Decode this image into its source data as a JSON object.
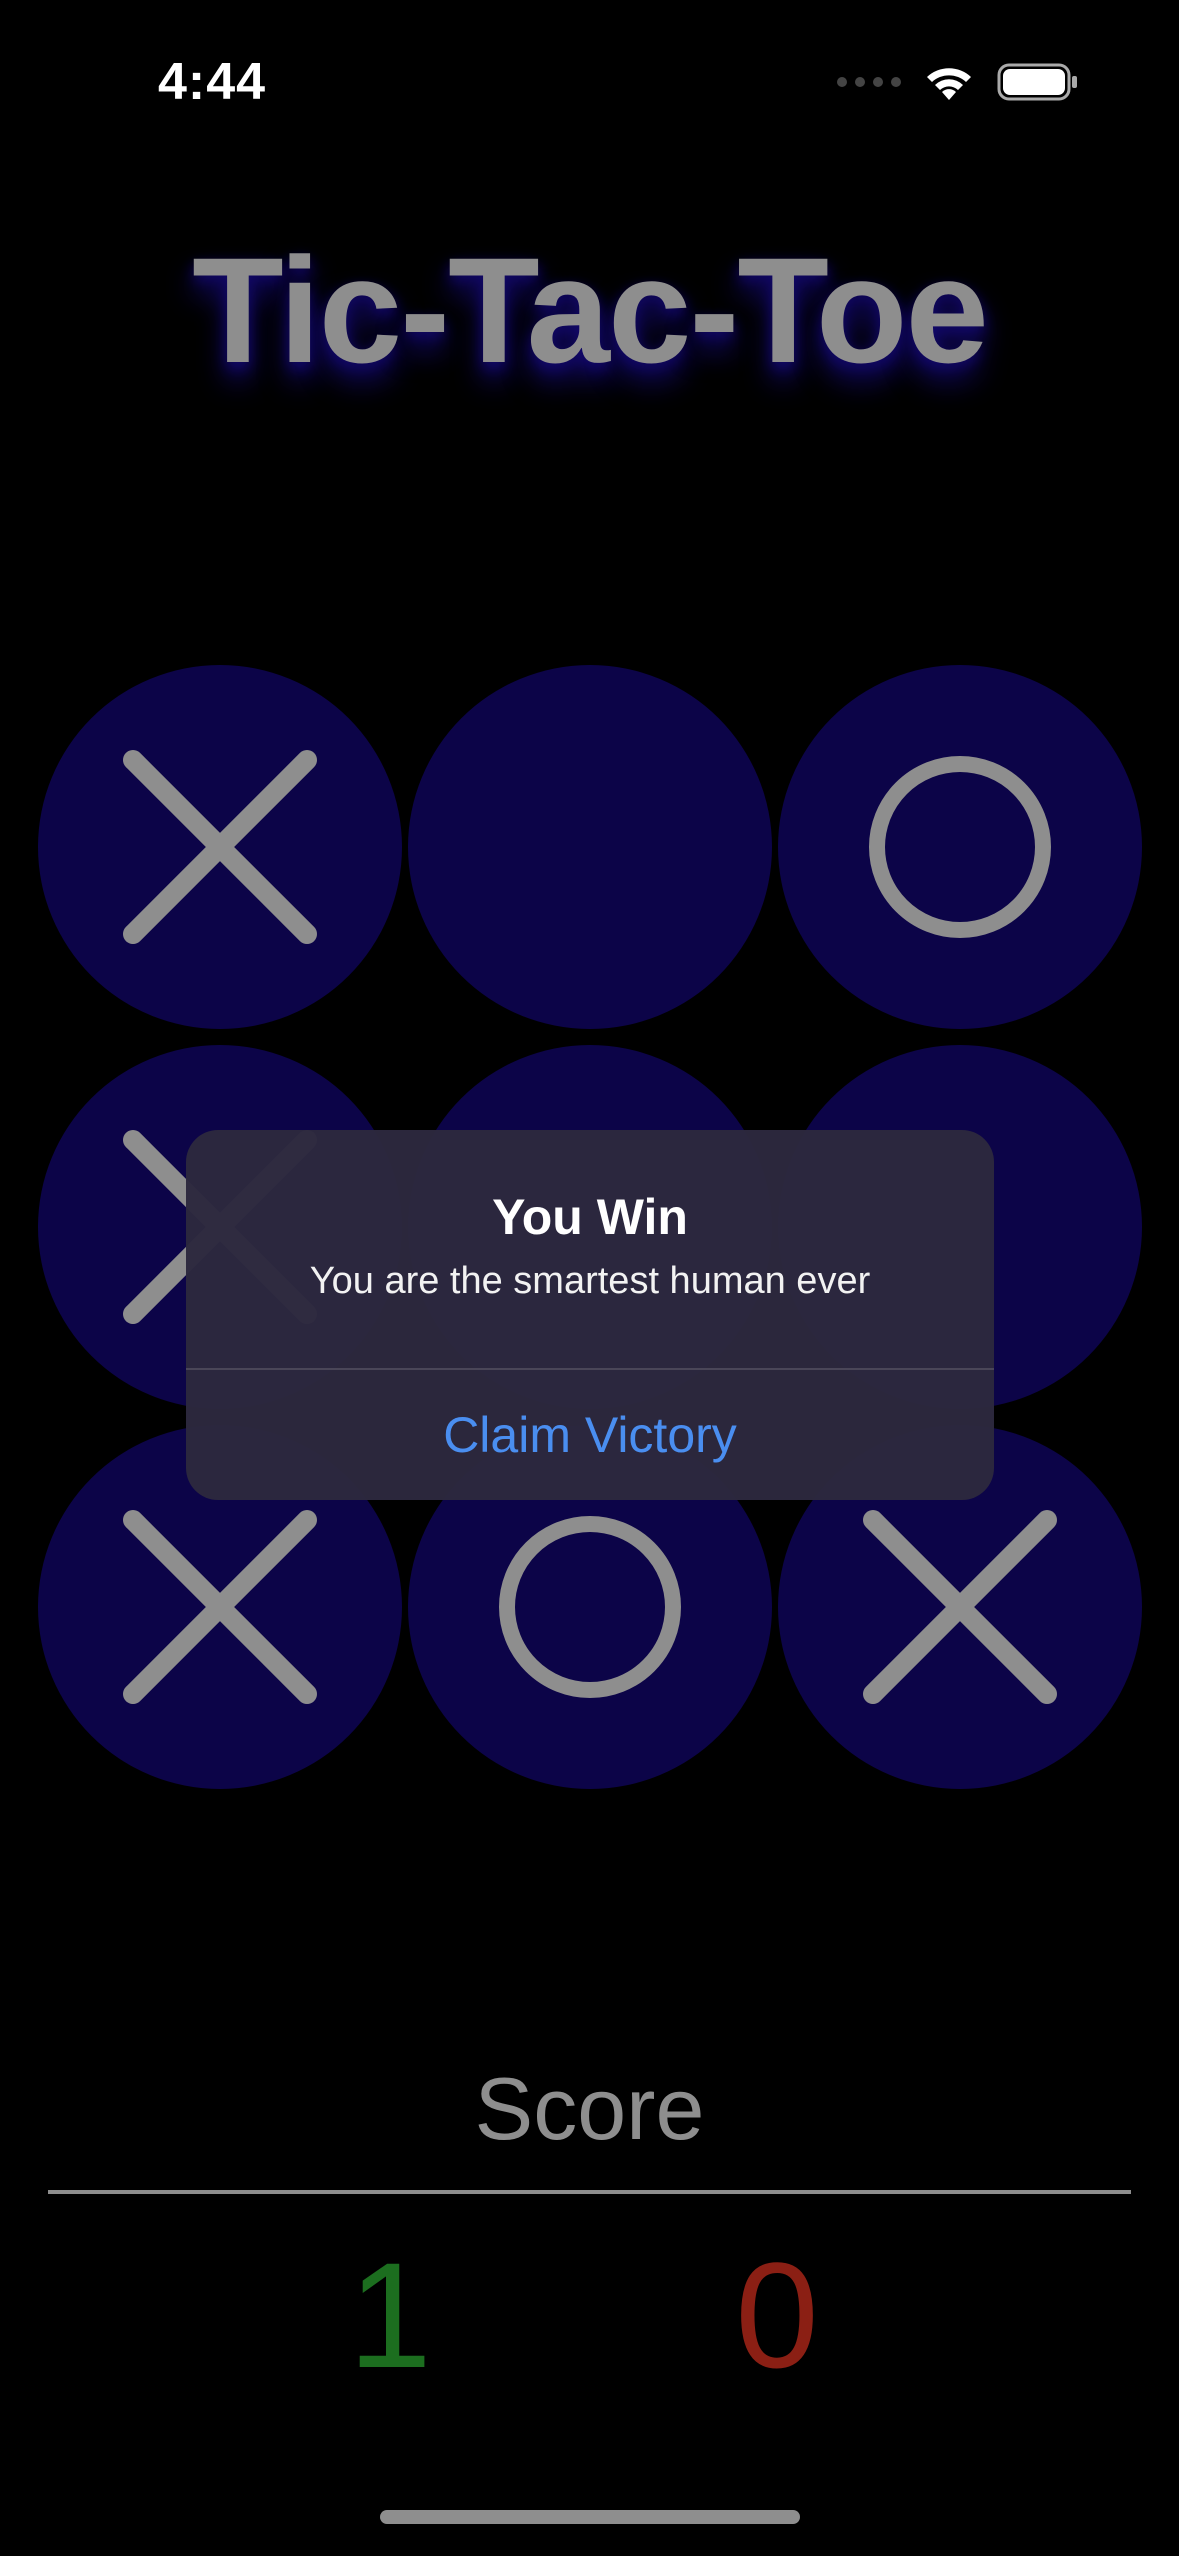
{
  "status_bar": {
    "time": "4:44",
    "icons": [
      "signal-icon",
      "wifi-icon",
      "battery-icon"
    ]
  },
  "app": {
    "title": "Tic-Tac-Toe"
  },
  "board": {
    "cells": [
      "X",
      "",
      "O",
      "X",
      "",
      "",
      "X",
      "O",
      "X"
    ]
  },
  "alert": {
    "title": "You Win",
    "message": "You are the smartest human ever",
    "button_label": "Claim Victory"
  },
  "score": {
    "label": "Score",
    "player": "1",
    "computer": "0"
  },
  "colors": {
    "cell_background": "#0c0448",
    "mark": "#8e8e8e",
    "player_score": "#1c6e1f",
    "computer_score": "#8b1f14",
    "alert_button": "#4a8ef0"
  }
}
